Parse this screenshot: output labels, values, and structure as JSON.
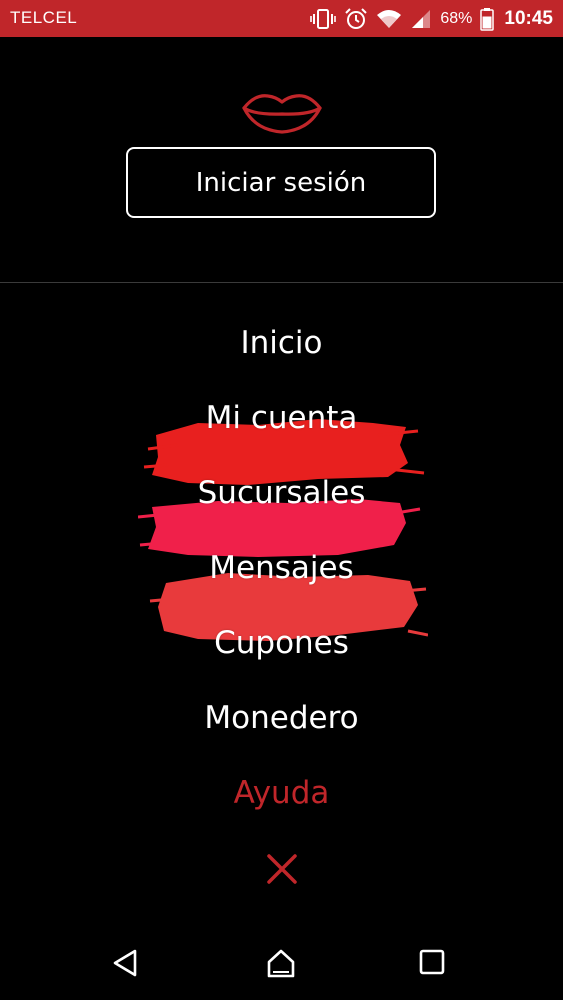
{
  "status_bar": {
    "carrier": "TELCEL",
    "battery_percent": "68%",
    "time": "10:45",
    "icons": [
      "vibrate-icon",
      "alarm-icon",
      "wifi-icon",
      "cell-signal-icon",
      "battery-icon"
    ]
  },
  "header": {
    "logo_icon": "lips-icon",
    "login_label": "Iniciar sesión"
  },
  "menu": {
    "items": [
      {
        "label": "Inicio"
      },
      {
        "label": "Mi cuenta"
      },
      {
        "label": "Sucursales"
      },
      {
        "label": "Mensajes"
      },
      {
        "label": "Cupones"
      },
      {
        "label": "Monedero"
      },
      {
        "label": "Ayuda"
      }
    ],
    "close_icon": "close-icon"
  },
  "nav_bar": {
    "icons": [
      "back-icon",
      "home-icon",
      "recents-icon"
    ]
  },
  "colors": {
    "accent": "#c0262a",
    "background": "#000000",
    "text": "#ffffff",
    "stroke_red": "#e8201f",
    "stroke_pink": "#f0204a",
    "stroke_coral": "#e83a3c"
  }
}
